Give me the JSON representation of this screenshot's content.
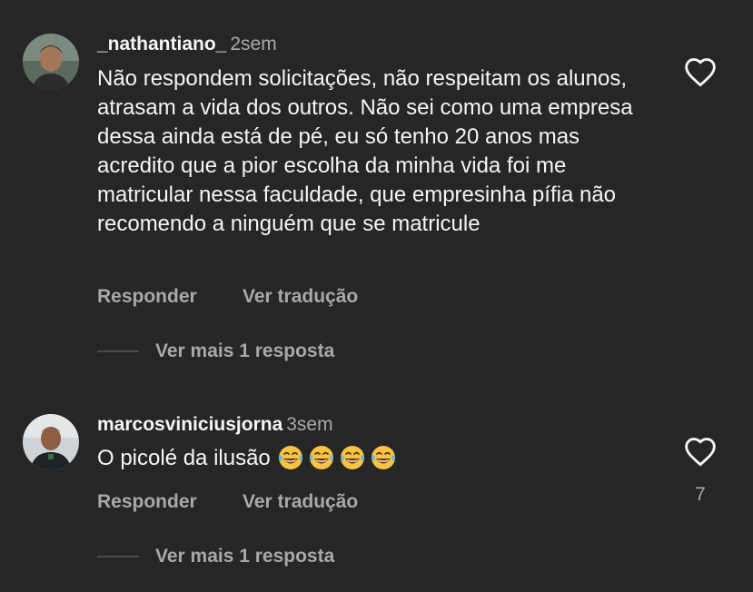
{
  "comments": [
    {
      "username": "_nathantiano_",
      "time": "2sem",
      "text": "Não respondem solicitações, não respeitam os alunos, atrasam a vida dos outros. Não sei como uma empresa dessa ainda está de pé, eu só tenho 20 anos mas acredito que a pior escolha da minha vida foi me matricular nessa faculdade, que empresinha pífia não recomendo a ninguém que se matricule",
      "reply_label": "Responder",
      "translate_label": "Ver tradução",
      "more_replies_label": "Ver mais 1 resposta",
      "like_icon": "heart-outline-icon"
    },
    {
      "username": "marcosviniciusjorna",
      "time": "3sem",
      "text": "O picolé da ilusão",
      "emojis": [
        "😂",
        "😂",
        "😂",
        "😂"
      ],
      "reply_label": "Responder",
      "translate_label": "Ver tradução",
      "more_replies_label": "Ver mais 1 resposta",
      "like_icon": "heart-outline-icon",
      "like_count": "7"
    }
  ],
  "colors": {
    "background": "#262626",
    "primary_text": "#f5f5f5",
    "secondary_text": "#a8a8a8"
  }
}
